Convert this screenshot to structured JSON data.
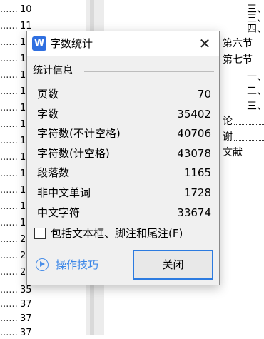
{
  "document": {
    "left_entries": [
      {
        "dots": "......",
        "num": "10"
      },
      {
        "dots": "......",
        "num": "11"
      },
      {
        "dots": "......",
        "num": "1"
      },
      {
        "dots": "......",
        "num": "1"
      },
      {
        "dots": "......",
        "num": "1"
      },
      {
        "dots": "......",
        "num": "1"
      },
      {
        "dots": "......",
        "num": "1"
      },
      {
        "dots": "......",
        "num": "1"
      },
      {
        "dots": "......",
        "num": "1"
      },
      {
        "dots": "......",
        "num": "1"
      },
      {
        "dots": "......",
        "num": "1"
      },
      {
        "dots": "......",
        "num": "1"
      },
      {
        "dots": "......",
        "num": "1"
      },
      {
        "dots": "......",
        "num": "1"
      },
      {
        "dots": "......",
        "num": "2"
      },
      {
        "dots": "......",
        "num": "2"
      },
      {
        "dots": "......",
        "num": "2"
      },
      {
        "dots": "......",
        "num": "2"
      },
      {
        "dots": "......",
        "num": "2"
      },
      {
        "dots": "......",
        "num": "2"
      },
      {
        "dots": "......",
        "num": "2"
      },
      {
        "dots": "......",
        "num": "2"
      },
      {
        "dots": "......",
        "num": "2"
      },
      {
        "dots": "......",
        "num": "2"
      },
      {
        "dots": "......",
        "num": "35"
      },
      {
        "dots": "......",
        "num": "37"
      },
      {
        "dots": "......",
        "num": "37"
      },
      {
        "dots": "......",
        "num": "37"
      }
    ],
    "right_entries": [
      "三、",
      "三、",
      "四、",
      "第六节",
      "第七节",
      "一、",
      "二、",
      "三、",
      "论",
      "谢",
      "文献"
    ]
  },
  "dialog": {
    "app_icon_letter": "W",
    "title": "字数统计",
    "close_glyph": "✕",
    "section_label": "统计信息",
    "stats": [
      {
        "label": "页数",
        "value": "70"
      },
      {
        "label": "字数",
        "value": "35402"
      },
      {
        "label": "字符数(不计空格)",
        "value": "40706"
      },
      {
        "label": "字符数(计空格)",
        "value": "43078"
      },
      {
        "label": "段落数",
        "value": "1165"
      },
      {
        "label": "非中文单词",
        "value": "1728"
      },
      {
        "label": "中文字符",
        "value": "33674"
      }
    ],
    "checkbox_label": "包括文本框、脚注和尾注(",
    "checkbox_hotkey": "F",
    "checkbox_label_end": ")",
    "checkbox_checked": false,
    "tips_label": "操作技巧",
    "tips_icon": "play-circle-icon",
    "close_button_label": "关闭",
    "accent_color": "#2c7be0"
  }
}
